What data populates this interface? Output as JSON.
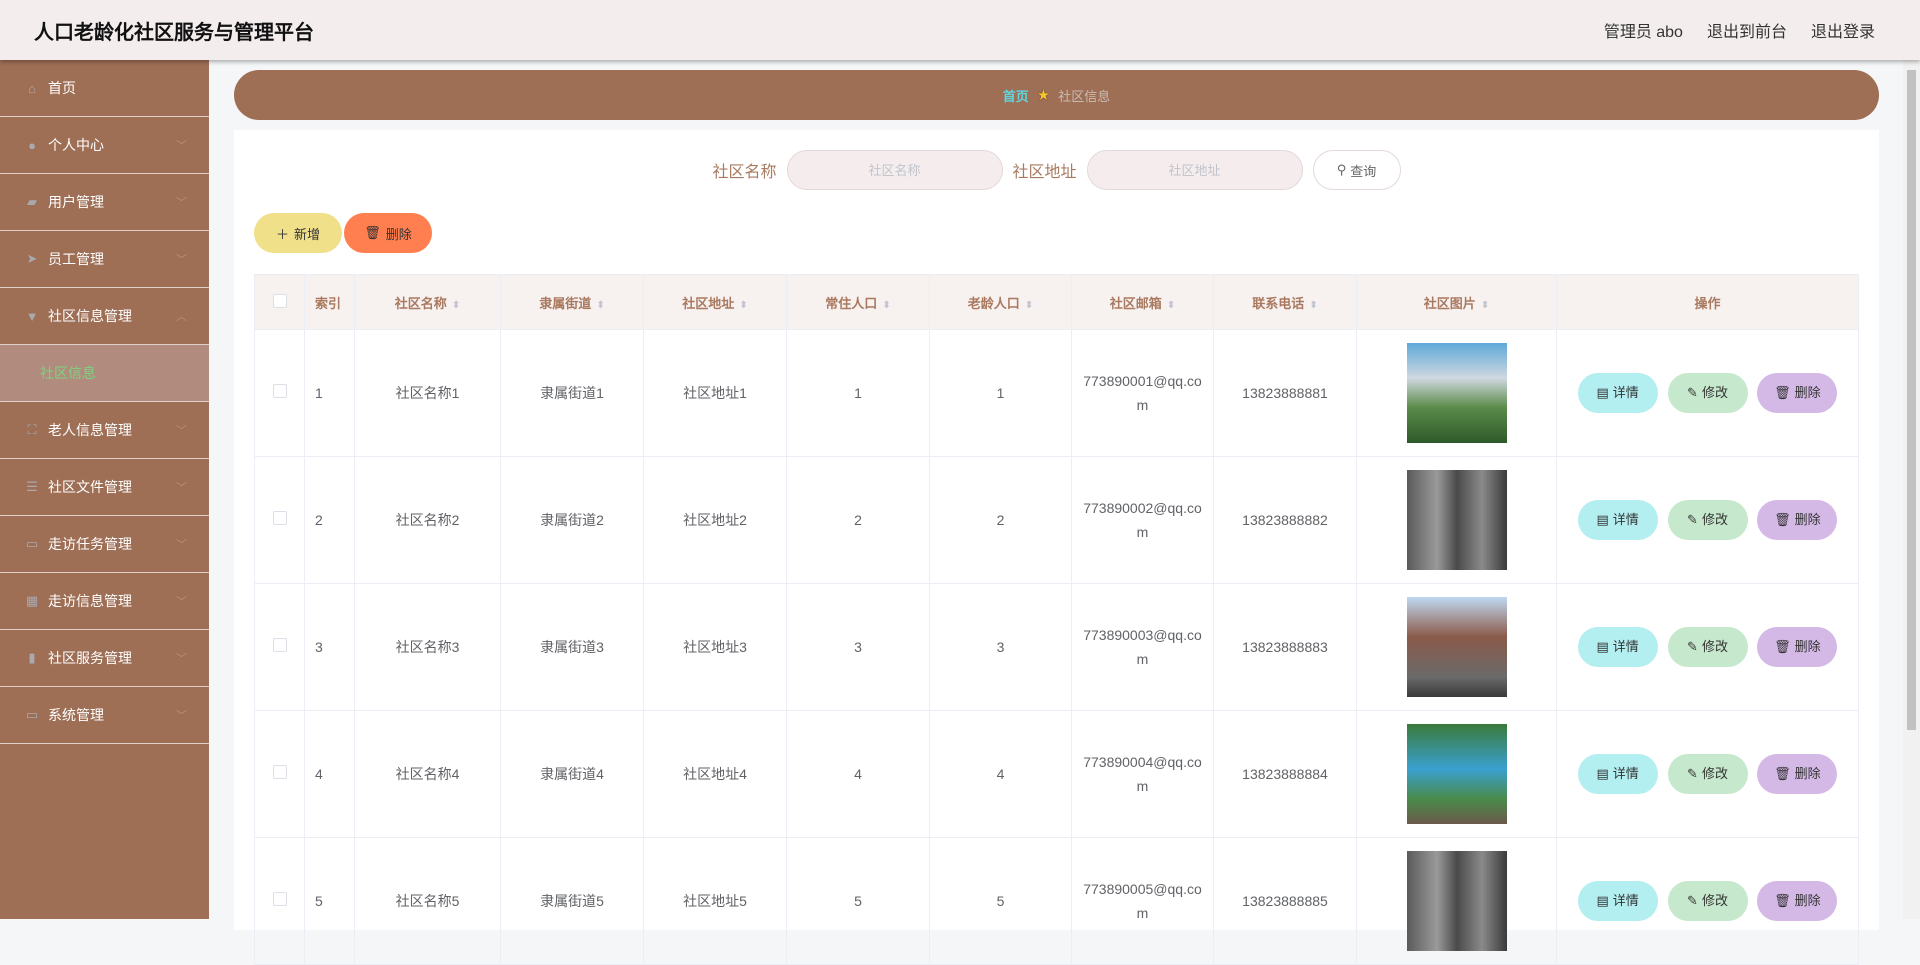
{
  "header": {
    "title": "人口老龄化社区服务与管理平台",
    "user": "管理员 abo",
    "to_front": "退出到前台",
    "logout": "退出登录"
  },
  "sidebar": {
    "items": [
      {
        "label": "首页",
        "icon": "home-icon",
        "glyph": "⌂"
      },
      {
        "label": "个人中心",
        "icon": "user-icon",
        "glyph": "●"
      },
      {
        "label": "用户管理",
        "icon": "briefcase-icon",
        "glyph": "▰"
      },
      {
        "label": "员工管理",
        "icon": "send-icon",
        "glyph": "➤"
      },
      {
        "label": "社区信息管理",
        "icon": "pin-icon",
        "glyph": "▼"
      },
      {
        "label": "社区信息",
        "icon": ""
      },
      {
        "label": "老人信息管理",
        "icon": "frame-icon",
        "glyph": "⛶"
      },
      {
        "label": "社区文件管理",
        "icon": "list-icon",
        "glyph": "☰"
      },
      {
        "label": "走访任务管理",
        "icon": "card-icon",
        "glyph": "▭"
      },
      {
        "label": "走访信息管理",
        "icon": "grid-icon",
        "glyph": "▦"
      },
      {
        "label": "社区服务管理",
        "icon": "chart-icon",
        "glyph": "▮"
      },
      {
        "label": "系统管理",
        "icon": "chat-icon",
        "glyph": "▭"
      }
    ]
  },
  "breadcrumb": {
    "home": "首页",
    "current": "社区信息"
  },
  "search": {
    "name_label": "社区名称",
    "name_placeholder": "社区名称",
    "address_label": "社区地址",
    "address_placeholder": "社区地址",
    "query": "查询"
  },
  "actions": {
    "add": "新增",
    "delete": "删除"
  },
  "table": {
    "headers": [
      "索引",
      "社区名称",
      "隶属街道",
      "社区地址",
      "常住人口",
      "老龄人口",
      "社区邮箱",
      "联系电话",
      "社区图片",
      "操作"
    ],
    "row_actions": {
      "detail": "详情",
      "edit": "修改",
      "delete": "删除"
    },
    "rows": [
      {
        "index": "1",
        "name": "社区名称1",
        "street": "隶属街道1",
        "address": "社区地址1",
        "resident": "1",
        "elderly": "1",
        "email": "773890001@qq.com",
        "phone": "13823888881"
      },
      {
        "index": "2",
        "name": "社区名称2",
        "street": "隶属街道2",
        "address": "社区地址2",
        "resident": "2",
        "elderly": "2",
        "email": "773890002@qq.com",
        "phone": "13823888882"
      },
      {
        "index": "3",
        "name": "社区名称3",
        "street": "隶属街道3",
        "address": "社区地址3",
        "resident": "3",
        "elderly": "3",
        "email": "773890003@qq.com",
        "phone": "13823888883"
      },
      {
        "index": "4",
        "name": "社区名称4",
        "street": "隶属街道4",
        "address": "社区地址4",
        "resident": "4",
        "elderly": "4",
        "email": "773890004@qq.com",
        "phone": "13823888884"
      },
      {
        "index": "5",
        "name": "社区名称5",
        "street": "隶属街道5",
        "address": "社区地址5",
        "resident": "5",
        "elderly": "5",
        "email": "773890005@qq.com",
        "phone": "13823888885"
      }
    ]
  },
  "colors": {
    "brand": "#9e6e55",
    "active_text": "#7ed37e",
    "crumb_home": "#5fd6e0"
  }
}
